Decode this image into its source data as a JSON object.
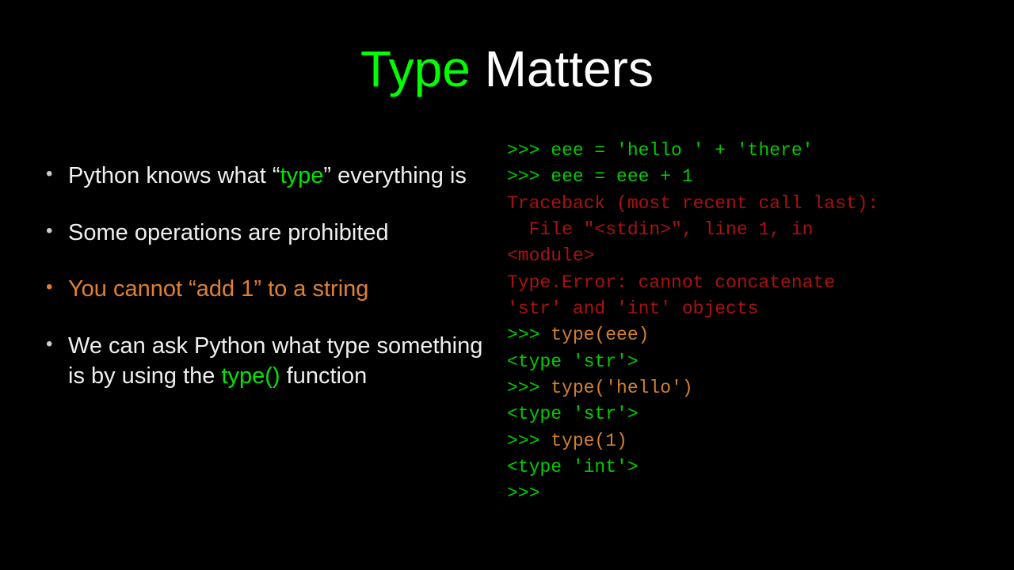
{
  "title": {
    "word1": "Type",
    "word2": " Matters"
  },
  "bullets": {
    "b1_pre": "Python knows what “",
    "b1_hl": "type",
    "b1_post": "” everything is",
    "b2": "Some operations are prohibited",
    "b3": "You cannot “add 1” to a string",
    "b4_pre": "We can ask Python what type something is by using the ",
    "b4_hl": "type()",
    "b4_post": " function"
  },
  "code": {
    "l01a": ">>> ",
    "l01b": "eee = 'hello ' + 'there'",
    "l02a": ">>> ",
    "l02b": "eee = eee + 1",
    "l03": "Traceback (most recent call last):",
    "l04": "  File \"<stdin>\", line 1, in ",
    "l05": "<module>",
    "l06": "Type.Error: cannot concatenate ",
    "l07": "'str' and 'int' objects",
    "l08a": ">>> ",
    "l08b": "type(eee)",
    "l09": "<type 'str'>",
    "l10a": ">>> ",
    "l10b": "type('hello')",
    "l11": "<type 'str'>",
    "l12a": ">>> ",
    "l12b": "type(1)",
    "l13": "<type 'int'>",
    "l14": ">>> "
  }
}
